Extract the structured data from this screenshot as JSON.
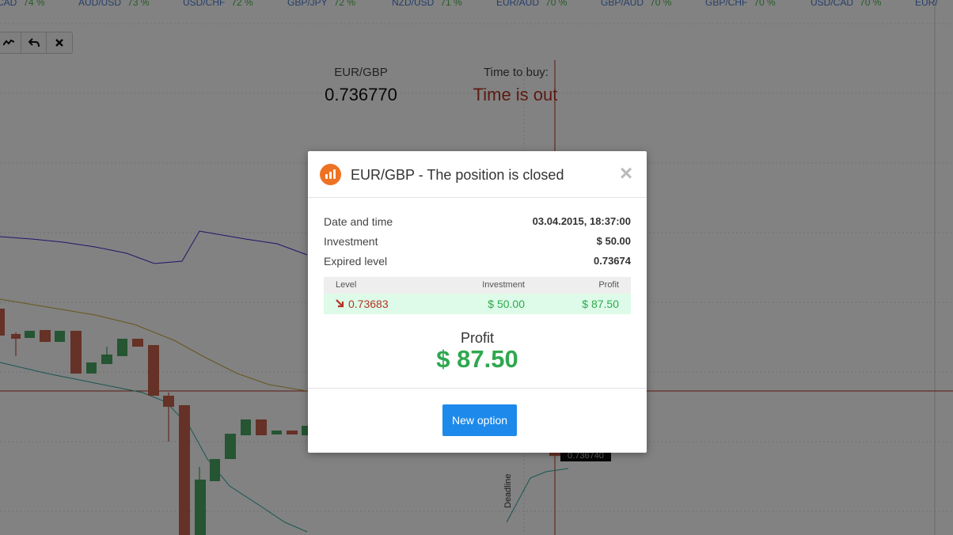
{
  "ticker": [
    {
      "pair": "CAD",
      "pct": "74 %"
    },
    {
      "pair": "AUD/USD",
      "pct": "73 %"
    },
    {
      "pair": "USD/CHF",
      "pct": "72 %"
    },
    {
      "pair": "GBP/JPY",
      "pct": "72 %"
    },
    {
      "pair": "NZD/USD",
      "pct": "71 %"
    },
    {
      "pair": "EUR/AUD",
      "pct": "70 %"
    },
    {
      "pair": "GBP/AUD",
      "pct": "70 %"
    },
    {
      "pair": "GBP/CHF",
      "pct": "70 %"
    },
    {
      "pair": "USD/CAD",
      "pct": "70 %"
    },
    {
      "pair": "EUR/",
      "pct": ""
    }
  ],
  "toolbar": {
    "items": [
      {
        "icon": "line-chart-icon"
      },
      {
        "icon": "undo-icon"
      },
      {
        "icon": "close-icon"
      }
    ]
  },
  "chart": {
    "asset": "EUR/GBP",
    "price": "0.736770",
    "time_to_buy_label": "Time to buy:",
    "time_to_buy_value": "Time is out",
    "price_tag": "0.736740",
    "deadline_label": "Deadline"
  },
  "modal": {
    "title": "EUR/GBP - The position is closed",
    "icon": "bar-chart-icon",
    "close_icon": "close-icon",
    "rows": [
      {
        "label": "Date and time",
        "value": "03.04.2015, 18:37:00"
      },
      {
        "label": "Investment",
        "value": "$ 50.00"
      },
      {
        "label": "Expired level",
        "value": "0.73674"
      }
    ],
    "table": {
      "headers": {
        "level": "Level",
        "investment": "Investment",
        "profit": "Profit"
      },
      "row": {
        "level": "0.73683",
        "investment": "$ 50.00",
        "profit": "$ 87.50",
        "direction_icon": "arrow-down-icon"
      }
    },
    "profit_label": "Profit",
    "profit_value": "$ 87.50",
    "new_option_label": "New option"
  },
  "colors": {
    "accent_blue": "#1d8aeb",
    "profit_green": "#2fa84f",
    "loss_red": "#b53424",
    "brand_orange": "#ee7224"
  }
}
